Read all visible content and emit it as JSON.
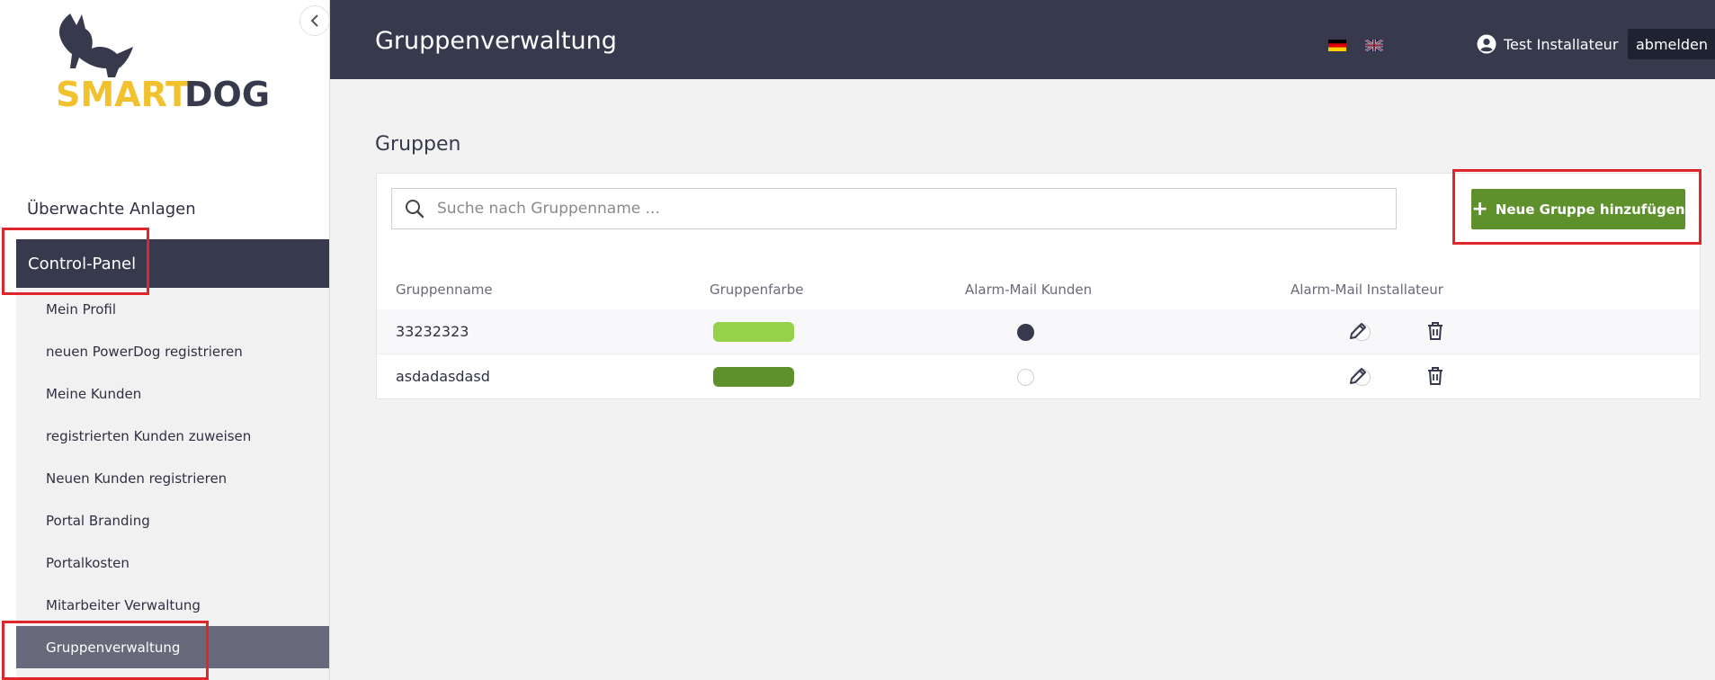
{
  "sidebar": {
    "logo_part1": "SMART",
    "logo_part2": "DOG",
    "nav_top": "Überwachte Anlagen",
    "nav_active": "Control-Panel",
    "items": [
      {
        "label": "Mein Profil"
      },
      {
        "label": "neuen PowerDog registrieren"
      },
      {
        "label": "Meine Kunden"
      },
      {
        "label": "registrierten Kunden zuweisen"
      },
      {
        "label": "Neuen Kunden registrieren"
      },
      {
        "label": "Portal Branding"
      },
      {
        "label": "Portalkosten"
      },
      {
        "label": "Mitarbeiter Verwaltung"
      },
      {
        "label": "Gruppenverwaltung",
        "active": true
      }
    ]
  },
  "header": {
    "title": "Gruppenverwaltung",
    "user_name": "Test Installateur",
    "logout_label": "abmelden"
  },
  "main": {
    "section_title": "Gruppen",
    "search_placeholder": "Suche nach Gruppenname ...",
    "add_button_label": "Neue Gruppe hinzufügen",
    "columns": [
      "Gruppenname",
      "Gruppenfarbe",
      "Alarm-Mail Kunden",
      "Alarm-Mail Installateur"
    ],
    "rows": [
      {
        "name": "33232323",
        "color": "#95d14a",
        "alarm_mail_kunden": true,
        "alarm_mail_installateur": false
      },
      {
        "name": "asdadasdasd",
        "color": "#5e912c",
        "alarm_mail_kunden": false,
        "alarm_mail_installateur": false
      }
    ]
  },
  "icons": {
    "collapse": "chevron-left-icon",
    "search": "search-icon",
    "user": "user-circle-icon",
    "edit": "pencil-icon",
    "delete": "trash-icon",
    "add": "plus-icon"
  },
  "colors": {
    "header_bg": "#373a4d",
    "accent_yellow": "#f2c12e",
    "add_button_green": "#5e912c",
    "highlight_red": "#e0262a"
  }
}
